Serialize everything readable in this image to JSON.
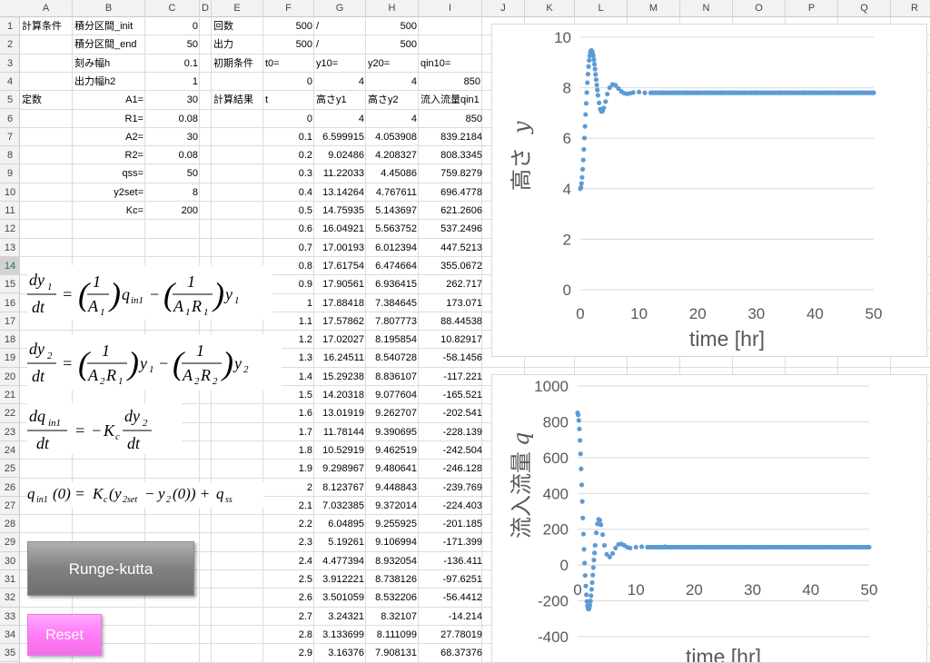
{
  "columns": [
    "A",
    "B",
    "C",
    "D",
    "E",
    "F",
    "G",
    "H",
    "I",
    "J",
    "K",
    "L",
    "M",
    "N",
    "O",
    "P",
    "Q",
    "R"
  ],
  "rows": [
    "1",
    "2",
    "3",
    "4",
    "5",
    "6",
    "7",
    "8",
    "9",
    "10",
    "11",
    "12",
    "13",
    "14",
    "15",
    "16",
    "17",
    "18",
    "19",
    "20",
    "21",
    "22",
    "23",
    "24",
    "25",
    "26",
    "27",
    "28",
    "29",
    "30",
    "31",
    "32",
    "33",
    "34",
    "35"
  ],
  "labels": {
    "keisan_jouken": "計算条件",
    "init_label": "積分区間_init",
    "end_label": "積分区間_end",
    "h_label": "刻み幅h",
    "h2_label": "出力幅h2",
    "teisu": "定数",
    "A1": "A1=",
    "R1": "R1=",
    "A2": "A2=",
    "R2": "R2=",
    "qss": "qss=",
    "y2set": "y2set=",
    "Kc": "Kc=",
    "kaisu": "回数",
    "shutsuryoku": "出力",
    "shoki_jouken": "初期条件",
    "t0": "t0=",
    "y10": "y10=",
    "y20": "y20=",
    "qin10": "qin10=",
    "slash1": "/",
    "slash2": "/",
    "keisan_kekka": "計算結果",
    "t": "t",
    "col_y1": "高さy1",
    "col_y2": "高さy2",
    "col_q": "流入流量qin1"
  },
  "values": {
    "init": "0",
    "end": "50",
    "h": "0.1",
    "h2": "1",
    "A1": "30",
    "R1": "0.08",
    "A2": "30",
    "R2": "0.08",
    "qss": "50",
    "y2set": "8",
    "Kc": "200",
    "kaisu_a": "500",
    "kaisu_b": "500",
    "out_a": "500",
    "out_b": "500",
    "t0": "0",
    "y10": "4",
    "y20": "4",
    "qin10": "850"
  },
  "results": [
    [
      "0",
      "4",
      "4",
      "850"
    ],
    [
      "0.1",
      "6.599915",
      "4.053908",
      "839.2184"
    ],
    [
      "0.2",
      "9.02486",
      "4.208327",
      "808.3345"
    ],
    [
      "0.3",
      "11.22033",
      "4.45086",
      "759.8279"
    ],
    [
      "0.4",
      "13.14264",
      "4.767611",
      "696.4778"
    ],
    [
      "0.5",
      "14.75935",
      "5.143697",
      "621.2606"
    ],
    [
      "0.6",
      "16.04921",
      "5.563752",
      "537.2496"
    ],
    [
      "0.7",
      "17.00193",
      "6.012394",
      "447.5213"
    ],
    [
      "0.8",
      "17.61754",
      "6.474664",
      "355.0672"
    ],
    [
      "0.9",
      "17.90561",
      "6.936415",
      "262.717"
    ],
    [
      "1",
      "17.88418",
      "7.384645",
      "173.071"
    ],
    [
      "1.1",
      "17.57862",
      "7.807773",
      "88.44538"
    ],
    [
      "1.2",
      "17.02027",
      "8.195854",
      "10.82917"
    ],
    [
      "1.3",
      "16.24511",
      "8.540728",
      "-58.1456"
    ],
    [
      "1.4",
      "15.29238",
      "8.836107",
      "-117.221"
    ],
    [
      "1.5",
      "14.20318",
      "9.077604",
      "-165.521"
    ],
    [
      "1.6",
      "13.01919",
      "9.262707",
      "-202.541"
    ],
    [
      "1.7",
      "11.78144",
      "9.390695",
      "-228.139"
    ],
    [
      "1.8",
      "10.52919",
      "9.462519",
      "-242.504"
    ],
    [
      "1.9",
      "9.298967",
      "9.480641",
      "-246.128"
    ],
    [
      "2",
      "8.123767",
      "9.448843",
      "-239.769"
    ],
    [
      "2.1",
      "7.032385",
      "9.372014",
      "-224.403"
    ],
    [
      "2.2",
      "6.04895",
      "9.255925",
      "-201.185"
    ],
    [
      "2.3",
      "5.19261",
      "9.106994",
      "-171.399"
    ],
    [
      "2.4",
      "4.477394",
      "8.932054",
      "-136.411"
    ],
    [
      "2.5",
      "3.912221",
      "8.738126",
      "-97.6251"
    ],
    [
      "2.6",
      "3.501059",
      "8.532206",
      "-56.4412"
    ],
    [
      "2.7",
      "3.24321",
      "8.32107",
      "-14.214"
    ],
    [
      "2.8",
      "3.133699",
      "8.111099",
      "27.78019"
    ],
    [
      "2.9",
      "3.16376",
      "7.908131",
      "68.37376"
    ]
  ],
  "equations": {
    "eq1": "dy1/dt = (1/A1) qin1 − (1/(A1 R1)) y1",
    "eq2": "dy2/dt = (1/(A2 R1)) y1 − (1/(A2 R2)) y2",
    "eq3": "dqin1/dt = −Kc dy2/dt",
    "eq4": "qin1(0) = Kc(y2set − y2(0)) + qss"
  },
  "buttons": {
    "runge": "Runge-kutta",
    "reset": "Reset"
  },
  "colors": {
    "series": "#5b9bd5",
    "runge_button": "#8c8c8c",
    "reset_button": "#ff88f8",
    "selected_row": "#217346"
  },
  "chart_data": [
    {
      "type": "scatter",
      "title": "",
      "xlabel": "time [hr]",
      "ylabel": "高さ",
      "ylabel_var": "y",
      "xlim": [
        0,
        50
      ],
      "ylim": [
        0,
        10
      ],
      "xticks": [
        "0",
        "10",
        "20",
        "30",
        "40",
        "50"
      ],
      "yticks": [
        "0",
        "2",
        "4",
        "6",
        "8",
        "10"
      ],
      "grid": true,
      "series": [
        {
          "values_xy": [
            [
              0,
              4
            ],
            [
              0.1,
              4.05
            ],
            [
              0.2,
              4.21
            ],
            [
              0.3,
              4.45
            ],
            [
              0.4,
              4.77
            ],
            [
              0.5,
              5.14
            ],
            [
              0.6,
              5.56
            ],
            [
              0.7,
              6.01
            ],
            [
              0.8,
              6.47
            ],
            [
              0.9,
              6.94
            ],
            [
              1.0,
              7.38
            ],
            [
              1.1,
              7.81
            ],
            [
              1.2,
              8.2
            ],
            [
              1.3,
              8.54
            ],
            [
              1.4,
              8.84
            ],
            [
              1.5,
              9.08
            ],
            [
              1.6,
              9.26
            ],
            [
              1.7,
              9.39
            ],
            [
              1.8,
              9.46
            ],
            [
              1.9,
              9.48
            ],
            [
              2.0,
              9.45
            ],
            [
              2.1,
              9.37
            ],
            [
              2.2,
              9.26
            ],
            [
              2.3,
              9.11
            ],
            [
              2.4,
              8.93
            ],
            [
              2.5,
              8.74
            ],
            [
              2.6,
              8.53
            ],
            [
              2.7,
              8.32
            ],
            [
              2.8,
              8.11
            ],
            [
              2.9,
              7.91
            ],
            [
              3.0,
              7.7
            ],
            [
              3.2,
              7.4
            ],
            [
              3.4,
              7.15
            ],
            [
              3.6,
              7.06
            ],
            [
              3.8,
              7.08
            ],
            [
              4.0,
              7.2
            ],
            [
              4.3,
              7.45
            ],
            [
              4.6,
              7.75
            ],
            [
              5.0,
              8.0
            ],
            [
              5.5,
              8.13
            ],
            [
              6.0,
              8.1
            ],
            [
              6.5,
              7.97
            ],
            [
              7.0,
              7.85
            ],
            [
              7.5,
              7.78
            ],
            [
              8.0,
              7.76
            ],
            [
              8.5,
              7.78
            ],
            [
              9,
              7.81
            ],
            [
              10,
              7.83
            ],
            [
              11,
              7.8
            ],
            [
              12,
              7.8
            ],
            [
              14,
              7.8
            ],
            [
              16,
              7.8
            ],
            [
              18,
              7.8
            ],
            [
              20,
              7.8
            ],
            [
              22,
              7.8
            ],
            [
              24,
              7.8
            ],
            [
              26,
              7.8
            ],
            [
              28,
              7.8
            ],
            [
              30,
              7.8
            ],
            [
              32,
              7.8
            ],
            [
              34,
              7.8
            ],
            [
              36,
              7.8
            ],
            [
              38,
              7.8
            ],
            [
              40,
              7.8
            ],
            [
              42,
              7.8
            ],
            [
              44,
              7.8
            ],
            [
              46,
              7.8
            ],
            [
              48,
              7.8
            ],
            [
              50,
              7.8
            ]
          ]
        }
      ]
    },
    {
      "type": "scatter",
      "title": "",
      "xlabel": "time [hr]",
      "ylabel": "流入流量",
      "ylabel_var": "q",
      "xlim": [
        0,
        50
      ],
      "ylim": [
        -400,
        1000
      ],
      "xticks": [
        "0",
        "10",
        "20",
        "30",
        "40",
        "50"
      ],
      "yticks": [
        "-400",
        "-200",
        "0",
        "200",
        "400",
        "600",
        "800",
        "1000"
      ],
      "grid": true,
      "series": [
        {
          "values_xy": [
            [
              0,
              850
            ],
            [
              0.1,
              839
            ],
            [
              0.2,
              808
            ],
            [
              0.3,
              760
            ],
            [
              0.4,
              696
            ],
            [
              0.5,
              621
            ],
            [
              0.6,
              537
            ],
            [
              0.7,
              448
            ],
            [
              0.8,
              355
            ],
            [
              0.9,
              263
            ],
            [
              1.0,
              173
            ],
            [
              1.1,
              88
            ],
            [
              1.2,
              11
            ],
            [
              1.3,
              -58
            ],
            [
              1.4,
              -117
            ],
            [
              1.5,
              -166
            ],
            [
              1.6,
              -203
            ],
            [
              1.7,
              -228
            ],
            [
              1.8,
              -243
            ],
            [
              1.9,
              -246
            ],
            [
              2.0,
              -240
            ],
            [
              2.1,
              -224
            ],
            [
              2.2,
              -201
            ],
            [
              2.3,
              -171
            ],
            [
              2.4,
              -136
            ],
            [
              2.5,
              -98
            ],
            [
              2.6,
              -56
            ],
            [
              2.7,
              -14
            ],
            [
              2.8,
              28
            ],
            [
              2.9,
              68
            ],
            [
              3.0,
              110
            ],
            [
              3.2,
              180
            ],
            [
              3.4,
              230
            ],
            [
              3.6,
              255
            ],
            [
              3.8,
              250
            ],
            [
              4.0,
              225
            ],
            [
              4.3,
              170
            ],
            [
              4.6,
              110
            ],
            [
              5.0,
              60
            ],
            [
              5.5,
              45
            ],
            [
              6.0,
              65
            ],
            [
              6.5,
              95
            ],
            [
              7.0,
              115
            ],
            [
              7.5,
              118
            ],
            [
              8.0,
              110
            ],
            [
              8.5,
              100
            ],
            [
              9,
              95
            ],
            [
              10,
              100
            ],
            [
              11,
              102
            ],
            [
              12,
              100
            ],
            [
              14,
              100
            ],
            [
              15,
              102
            ],
            [
              16,
              100
            ],
            [
              18,
              100
            ],
            [
              20,
              100
            ],
            [
              22,
              100
            ],
            [
              24,
              100
            ],
            [
              26,
              100
            ],
            [
              28,
              100
            ],
            [
              30,
              100
            ],
            [
              32,
              100
            ],
            [
              34,
              100
            ],
            [
              36,
              100
            ],
            [
              38,
              100
            ],
            [
              40,
              100
            ],
            [
              42,
              100
            ],
            [
              44,
              100
            ],
            [
              46,
              100
            ],
            [
              48,
              100
            ],
            [
              50,
              100
            ]
          ]
        }
      ]
    }
  ]
}
